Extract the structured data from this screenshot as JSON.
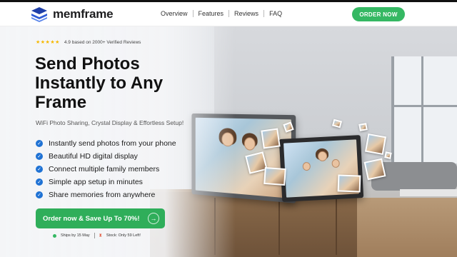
{
  "brand": {
    "name": "memframe",
    "logo_icon": "layered-squares-icon"
  },
  "nav": {
    "items": [
      {
        "label": "Overview"
      },
      {
        "label": "Features"
      },
      {
        "label": "Reviews"
      },
      {
        "label": "FAQ"
      }
    ],
    "cta_label": "ORDER NOW"
  },
  "hero": {
    "rating_stars": "★★★★★",
    "rating_text": "4.9 based on 2000+ Verified Reviews",
    "headline": "Send Photos Instantly to Any Frame",
    "subtitle": "WiFi Photo Sharing, Crystal Display & Effortless Setup!",
    "features": [
      {
        "label": "Instantly send photos from your phone"
      },
      {
        "label": "Beautiful HD digital display"
      },
      {
        "label": "Connect multiple family members"
      },
      {
        "label": "Simple app setup in minutes"
      },
      {
        "label": "Share memories from anywhere"
      }
    ],
    "order_button_label": "Order now & Save Up To 70%!",
    "ship_text": "Ships by 15 May",
    "stock_text": "Stock: Only 59 Left!"
  },
  "colors": {
    "accent_green": "#35b863",
    "check_blue": "#1f72d4",
    "star_gold": "#f5b800",
    "hourglass_red": "#e04b2e"
  }
}
